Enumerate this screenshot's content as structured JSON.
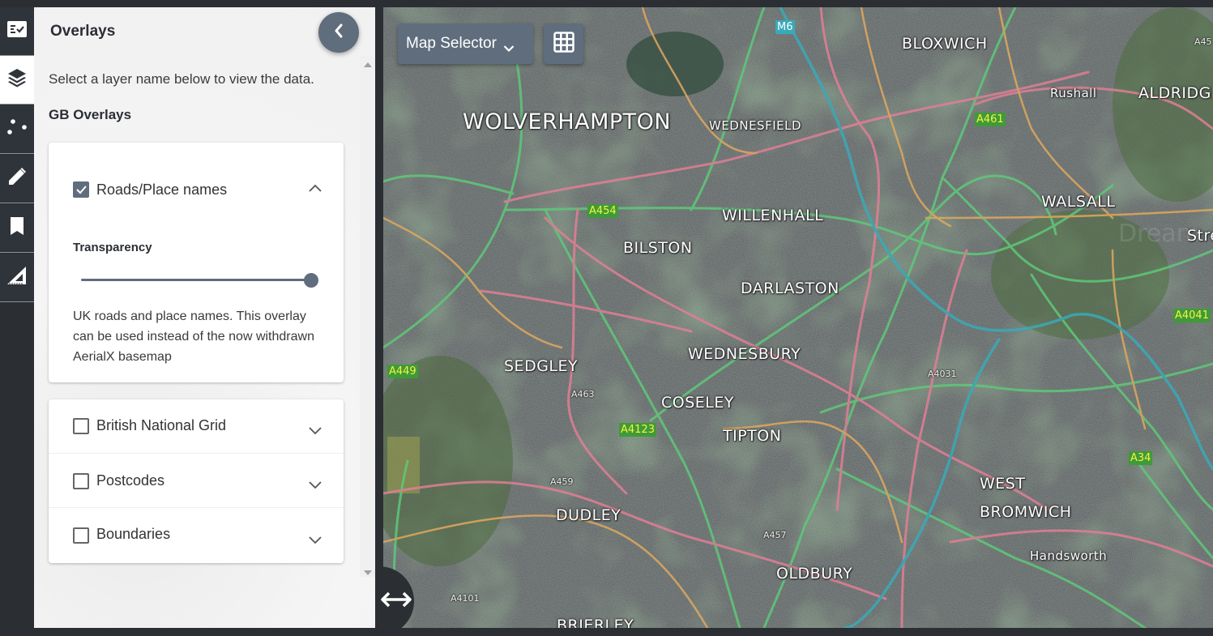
{
  "rail": {
    "items": [
      {
        "name": "legend",
        "icon": "checklist-icon",
        "active": false
      },
      {
        "name": "layers",
        "icon": "layers-icon",
        "active": true
      },
      {
        "name": "points",
        "icon": "scatter-dots-icon",
        "active": false
      },
      {
        "name": "draw",
        "icon": "pencil-icon",
        "active": false
      },
      {
        "name": "bookmarks",
        "icon": "bookmark-icon",
        "active": false
      },
      {
        "name": "measure",
        "icon": "set-square-icon",
        "active": false
      }
    ]
  },
  "panel": {
    "title": "Overlays",
    "collapse_icon": "chevron-left-icon",
    "intro": "Select a layer name below to view the data.",
    "section_heading": "GB Overlays",
    "overlays": [
      {
        "label": "Roads/Place names",
        "checked": true,
        "expanded": true,
        "transparency_label": "Transparency",
        "transparency_value": 1.0,
        "description": "UK roads and place names. This overlay can be used instead of the now withdrawn AerialX basemap"
      },
      {
        "label": "British National Grid",
        "checked": false,
        "expanded": false
      },
      {
        "label": "Postcodes",
        "checked": false,
        "expanded": false
      },
      {
        "label": "Boundaries",
        "checked": false,
        "expanded": false
      }
    ]
  },
  "map": {
    "selector_label": "Map Selector",
    "grid_icon": "grid-icon",
    "swipe_icon": "left-right-arrow-icon",
    "colors": {
      "control_bg": "#5f6d7d",
      "primary_road": "#5fc87a",
      "a_road": "#e07f95",
      "b_road": "#e0a85f",
      "motorway": "#3aaab8"
    },
    "places": [
      {
        "name": "WOLVERHAMPTON",
        "size": "big"
      },
      {
        "name": "WEDNESFIELD",
        "size": "sm"
      },
      {
        "name": "BLOXWICH",
        "size": "med"
      },
      {
        "name": "Rushall",
        "size": "sm"
      },
      {
        "name": "ALDRIDGE",
        "size": "med"
      },
      {
        "name": "WALSALL",
        "size": "med"
      },
      {
        "name": "WILLENHALL",
        "size": "med"
      },
      {
        "name": "BILSTON",
        "size": "med"
      },
      {
        "name": "DARLASTON",
        "size": "med"
      },
      {
        "name": "WEDNESBURY",
        "size": "med"
      },
      {
        "name": "SEDGLEY",
        "size": "med"
      },
      {
        "name": "COSELEY",
        "size": "med"
      },
      {
        "name": "TIPTON",
        "size": "med"
      },
      {
        "name": "DUDLEY",
        "size": "med"
      },
      {
        "name": "WEST",
        "size": "med"
      },
      {
        "name": "BROMWICH",
        "size": "med"
      },
      {
        "name": "Handsworth",
        "size": "sm"
      },
      {
        "name": "OLDBURY",
        "size": "med"
      },
      {
        "name": "BRIERLEY",
        "size": "med"
      },
      {
        "name": "Stre",
        "size": "med"
      }
    ],
    "road_shields": [
      {
        "ref": "M6",
        "type": "motorway"
      },
      {
        "ref": "A461",
        "type": "primary"
      },
      {
        "ref": "A454",
        "type": "primary"
      },
      {
        "ref": "A449",
        "type": "primary"
      },
      {
        "ref": "A4123",
        "type": "primary"
      },
      {
        "ref": "A4041",
        "type": "primary"
      },
      {
        "ref": "A34",
        "type": "primary"
      },
      {
        "ref": "A45",
        "type": "primary"
      }
    ],
    "road_labels": [
      "A463",
      "A4031",
      "A459",
      "A457",
      "A4101"
    ],
    "watermark": "Dream"
  }
}
